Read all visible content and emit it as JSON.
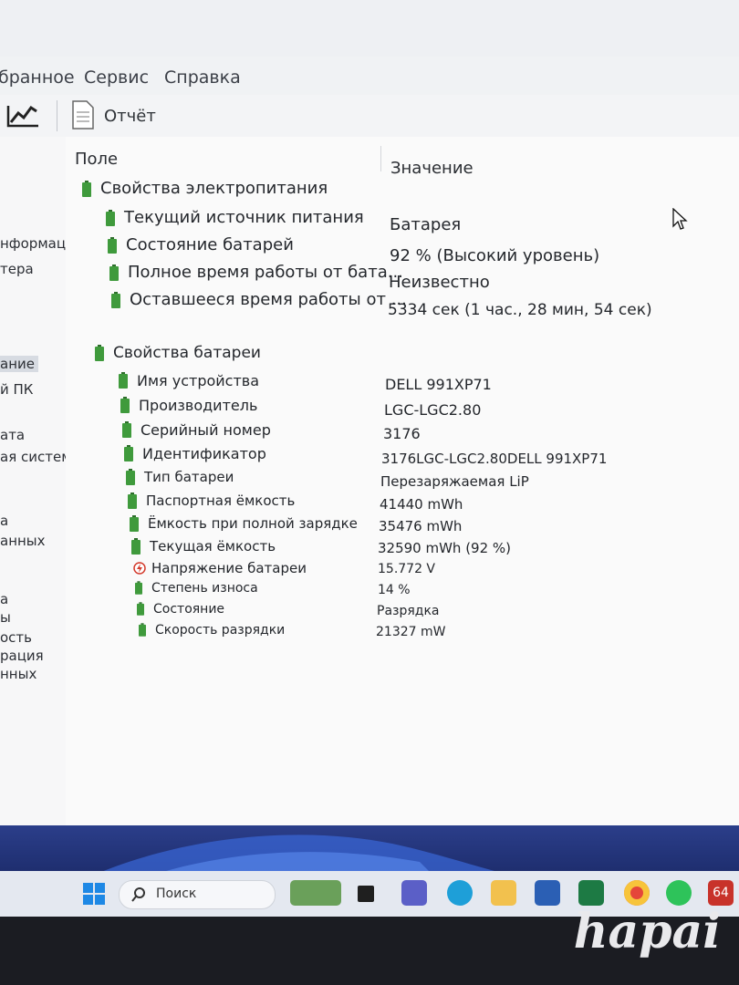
{
  "menu": {
    "favorites": "бранное",
    "service": "Сервис",
    "help": "Справка"
  },
  "toolbar": {
    "report_label": "Отчёт"
  },
  "sidebar": {
    "items": [
      "нформац",
      "тера",
      "ание",
      "й ПК",
      "ата",
      "ая система",
      "а",
      "анных",
      "а",
      "ы",
      "ость",
      "рация",
      "нных"
    ],
    "selected_index": 2
  },
  "table": {
    "col_field": "Поле",
    "col_value": "Значение",
    "groups": [
      {
        "title": "Свойства электропитания",
        "rows": [
          {
            "field": "Текущий источник питания",
            "value": "Батарея"
          },
          {
            "field": "Состояние батарей",
            "value": "92 % (Высокий уровень)"
          },
          {
            "field": "Полное время работы от бата...",
            "value": "Неизвестно"
          },
          {
            "field": "Оставшееся время работы от ...",
            "value": "5334 сек (1 час., 28 мин, 54 сек)"
          }
        ]
      },
      {
        "title": "Свойства батареи",
        "rows": [
          {
            "field": "Имя устройства",
            "value": "DELL 991XP71"
          },
          {
            "field": "Производитель",
            "value": "LGC-LGC2.80"
          },
          {
            "field": "Серийный номер",
            "value": "3176"
          },
          {
            "field": "Идентификатор",
            "value": "3176LGC-LGC2.80DELL 991XP71"
          },
          {
            "field": "Тип батареи",
            "value": "Перезаряжаемая LiP"
          },
          {
            "field": "Паспортная ёмкость",
            "value": "41440 mWh"
          },
          {
            "field": "Ёмкость при полной зарядке",
            "value": "35476 mWh"
          },
          {
            "field": "Текущая ёмкость",
            "value": "32590 mWh  (92 %)"
          },
          {
            "field": "Напряжение батареи",
            "value": "15.772 V"
          },
          {
            "field": "Степень износа",
            "value": "14 %"
          },
          {
            "field": "Состояние",
            "value": "Разрядка"
          },
          {
            "field": "Скорость разрядки",
            "value": "21327 mW"
          }
        ]
      }
    ]
  },
  "taskbar": {
    "search_label": "Поиск",
    "tray_badge": "64"
  },
  "watermark": "hapai",
  "colors": {
    "battery_icon": "#3f9a3c",
    "voltage_icon": "#d33a2c"
  }
}
